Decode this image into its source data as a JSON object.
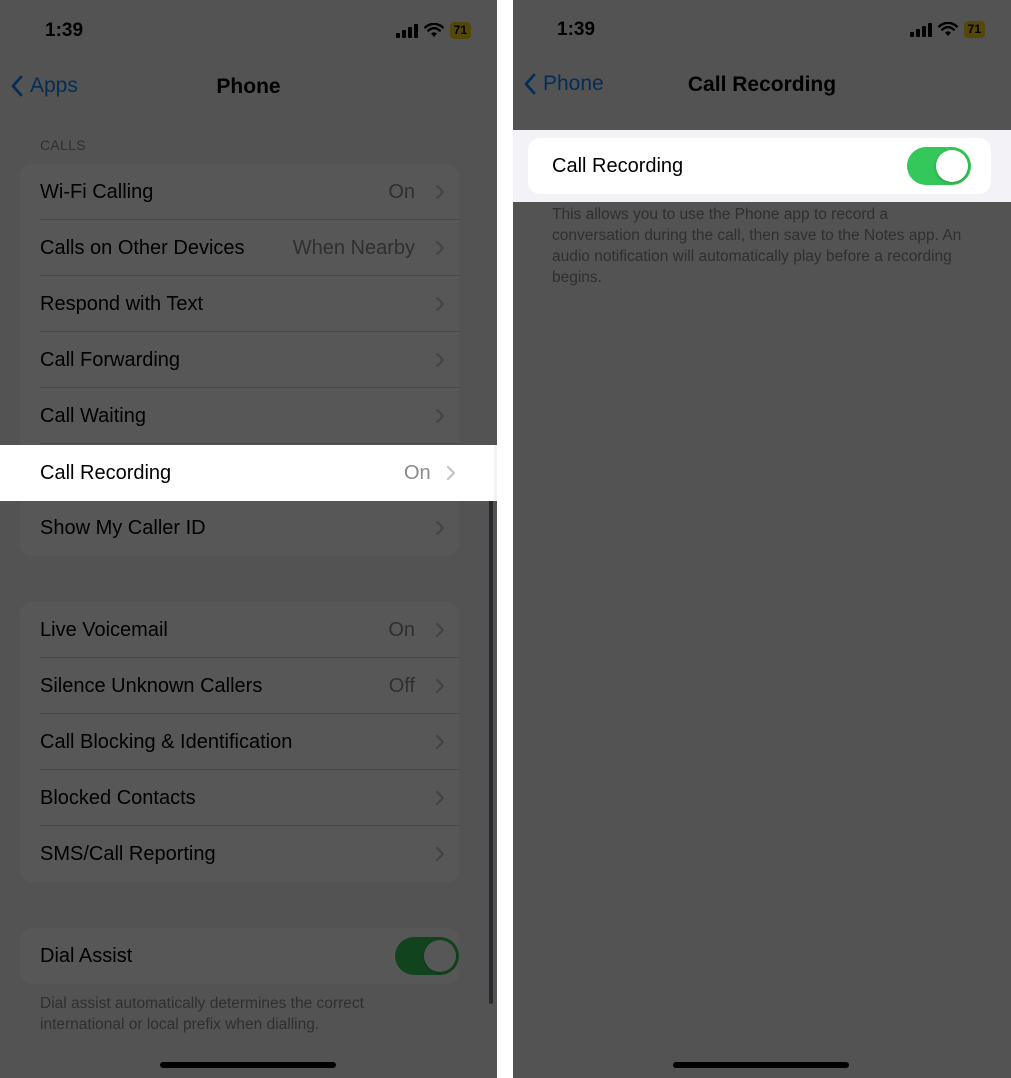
{
  "left": {
    "status": {
      "time": "1:39",
      "battery": "71"
    },
    "nav": {
      "back_label": "Apps",
      "title": "Phone"
    },
    "calls_header": "CALLS",
    "calls_rows": [
      {
        "label": "Wi-Fi Calling",
        "value": "On"
      },
      {
        "label": "Calls on Other Devices",
        "value": "When Nearby"
      },
      {
        "label": "Respond with Text",
        "value": ""
      },
      {
        "label": "Call Forwarding",
        "value": ""
      },
      {
        "label": "Call Waiting",
        "value": ""
      },
      {
        "label": "Call Recording",
        "value": "On"
      },
      {
        "label": "Show My Caller ID",
        "value": ""
      }
    ],
    "voicemail_rows": [
      {
        "label": "Live Voicemail",
        "value": "On"
      },
      {
        "label": "Silence Unknown Callers",
        "value": "Off"
      },
      {
        "label": "Call Blocking & Identification",
        "value": ""
      },
      {
        "label": "Blocked Contacts",
        "value": ""
      },
      {
        "label": "SMS/Call Reporting",
        "value": ""
      }
    ],
    "dial_assist": {
      "label": "Dial Assist",
      "enabled": true,
      "footnote": "Dial assist automatically determines the correct international or local prefix when dialling."
    }
  },
  "right": {
    "status": {
      "time": "1:39",
      "battery": "71"
    },
    "nav": {
      "back_label": "Phone",
      "title": "Call Recording"
    },
    "call_recording": {
      "label": "Call Recording",
      "enabled": true,
      "footnote": "This allows you to use the Phone app to record a conversation during the call, then save to the Notes app. An audio notification will automatically play before a recording begins."
    }
  },
  "colors": {
    "accent": "#0a84ff",
    "toggle_on": "#34c759",
    "battery": "#f5d21c"
  }
}
